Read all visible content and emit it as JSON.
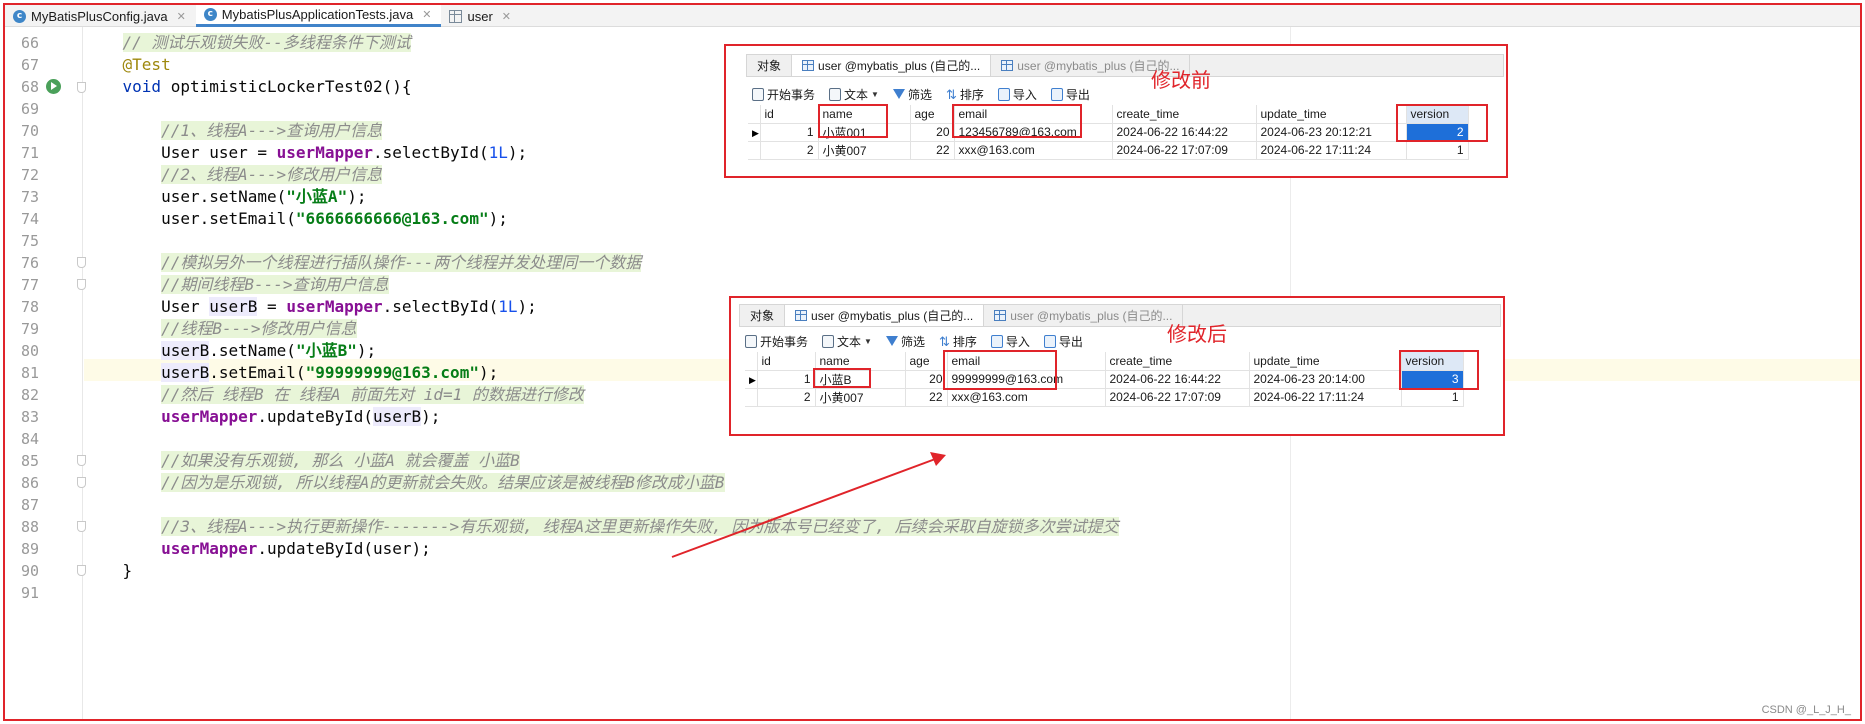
{
  "tabs": [
    {
      "label": "MyBatisPlusConfig.java",
      "icon": "class-icon",
      "active": false
    },
    {
      "label": "MybatisPlusApplicationTests.java",
      "icon": "class-icon",
      "active": true
    },
    {
      "label": "user",
      "icon": "table-icon",
      "active": false
    }
  ],
  "code": {
    "line_numbers": [
      "66",
      "67",
      "68",
      "69",
      "70",
      "71",
      "72",
      "73",
      "74",
      "75",
      "76",
      "77",
      "78",
      "79",
      "80",
      "81",
      "82",
      "83",
      "84",
      "85",
      "86",
      "87",
      "88",
      "89",
      "90",
      "91"
    ],
    "l66": "// 测试乐观锁失败--多线程条件下测试",
    "l67": "@Test",
    "l68_kw": "void",
    "l68_rest": " optimisticLockerTest02(){",
    "l70": "//1、线程A--->查询用户信息",
    "l71_a": "User user = ",
    "l71_f": "userMapper",
    "l71_b": ".selectById(",
    "l71_n": "1L",
    "l71_c": ");",
    "l72": "//2、线程A--->修改用户信息",
    "l73_a": "user.setName(",
    "l73_s": "\"小蓝A\"",
    "l73_c": ");",
    "l74_a": "user.setEmail(",
    "l74_s": "\"6666666666@163.com\"",
    "l74_c": ");",
    "l76": "//模拟另外一个线程进行插队操作---两个线程并发处理同一个数据",
    "l77": "//期间线程B--->查询用户信息",
    "l78_a": "User ",
    "l78_v": "userB",
    "l78_b": " = ",
    "l78_f": "userMapper",
    "l78_c": ".selectById(",
    "l78_n": "1L",
    "l78_d": ");",
    "l79": "//线程B--->修改用户信息",
    "l80_v": "userB",
    "l80_a": ".setName(",
    "l80_s": "\"小蓝B\"",
    "l80_c": ");",
    "l81_v": "userB",
    "l81_a": ".setEmail(",
    "l81_s": "\"99999999@163.com\"",
    "l81_c": ");",
    "l82": "//然后 线程B 在 线程A 前面先对 id=1 的数据进行修改",
    "l83_f": "userMapper",
    "l83_a": ".updateById(",
    "l83_v": "userB",
    "l83_c": ");",
    "l85": "//如果没有乐观锁, 那么 小蓝A 就会覆盖 小蓝B",
    "l86": "//因为是乐观锁, 所以线程A的更新就会失败。结果应该是被线程B修改成小蓝B",
    "l88": "//3、线程A--->执行更新操作------->有乐观锁, 线程A这里更新操作失败, 因为版本号已经变了, 后续会采取自旋锁多次尝试提交",
    "l89_f": "userMapper",
    "l89_a": ".updateById(user);",
    "l90": "}"
  },
  "panel_before": {
    "note": "修改前",
    "tabs": [
      "对象",
      "user @mybatis_plus (自己的...",
      "user @mybatis_plus (自己的..."
    ],
    "toolbar": [
      "开始事务",
      "文本",
      "筛选",
      "排序",
      "导入",
      "导出"
    ],
    "columns": [
      "id",
      "name",
      "age",
      "email",
      "create_time",
      "update_time",
      "version"
    ],
    "rows": [
      [
        "1",
        "小蓝001",
        "20",
        "123456789@163.com",
        "2024-06-22 16:44:22",
        "2024-06-23 20:12:21",
        "2"
      ],
      [
        "2",
        "小黄007",
        "22",
        "xxx@163.com",
        "2024-06-22 17:07:09",
        "2024-06-22 17:11:24",
        "1"
      ]
    ]
  },
  "panel_after": {
    "note": "修改后",
    "tabs": [
      "对象",
      "user @mybatis_plus (自己的...",
      "user @mybatis_plus (自己的..."
    ],
    "toolbar": [
      "开始事务",
      "文本",
      "筛选",
      "排序",
      "导入",
      "导出"
    ],
    "columns": [
      "id",
      "name",
      "age",
      "email",
      "create_time",
      "update_time",
      "version"
    ],
    "rows": [
      [
        "1",
        "小蓝B",
        "20",
        "99999999@163.com",
        "2024-06-22 16:44:22",
        "2024-06-23 20:14:00",
        "3"
      ],
      [
        "2",
        "小黄007",
        "22",
        "xxx@163.com",
        "2024-06-22 17:07:09",
        "2024-06-22 17:11:24",
        "1"
      ]
    ]
  },
  "watermark": "CSDN @_L_J_H_",
  "colors": {
    "annotation_red": "#e0242a",
    "selection_blue": "#1e6fd9"
  }
}
